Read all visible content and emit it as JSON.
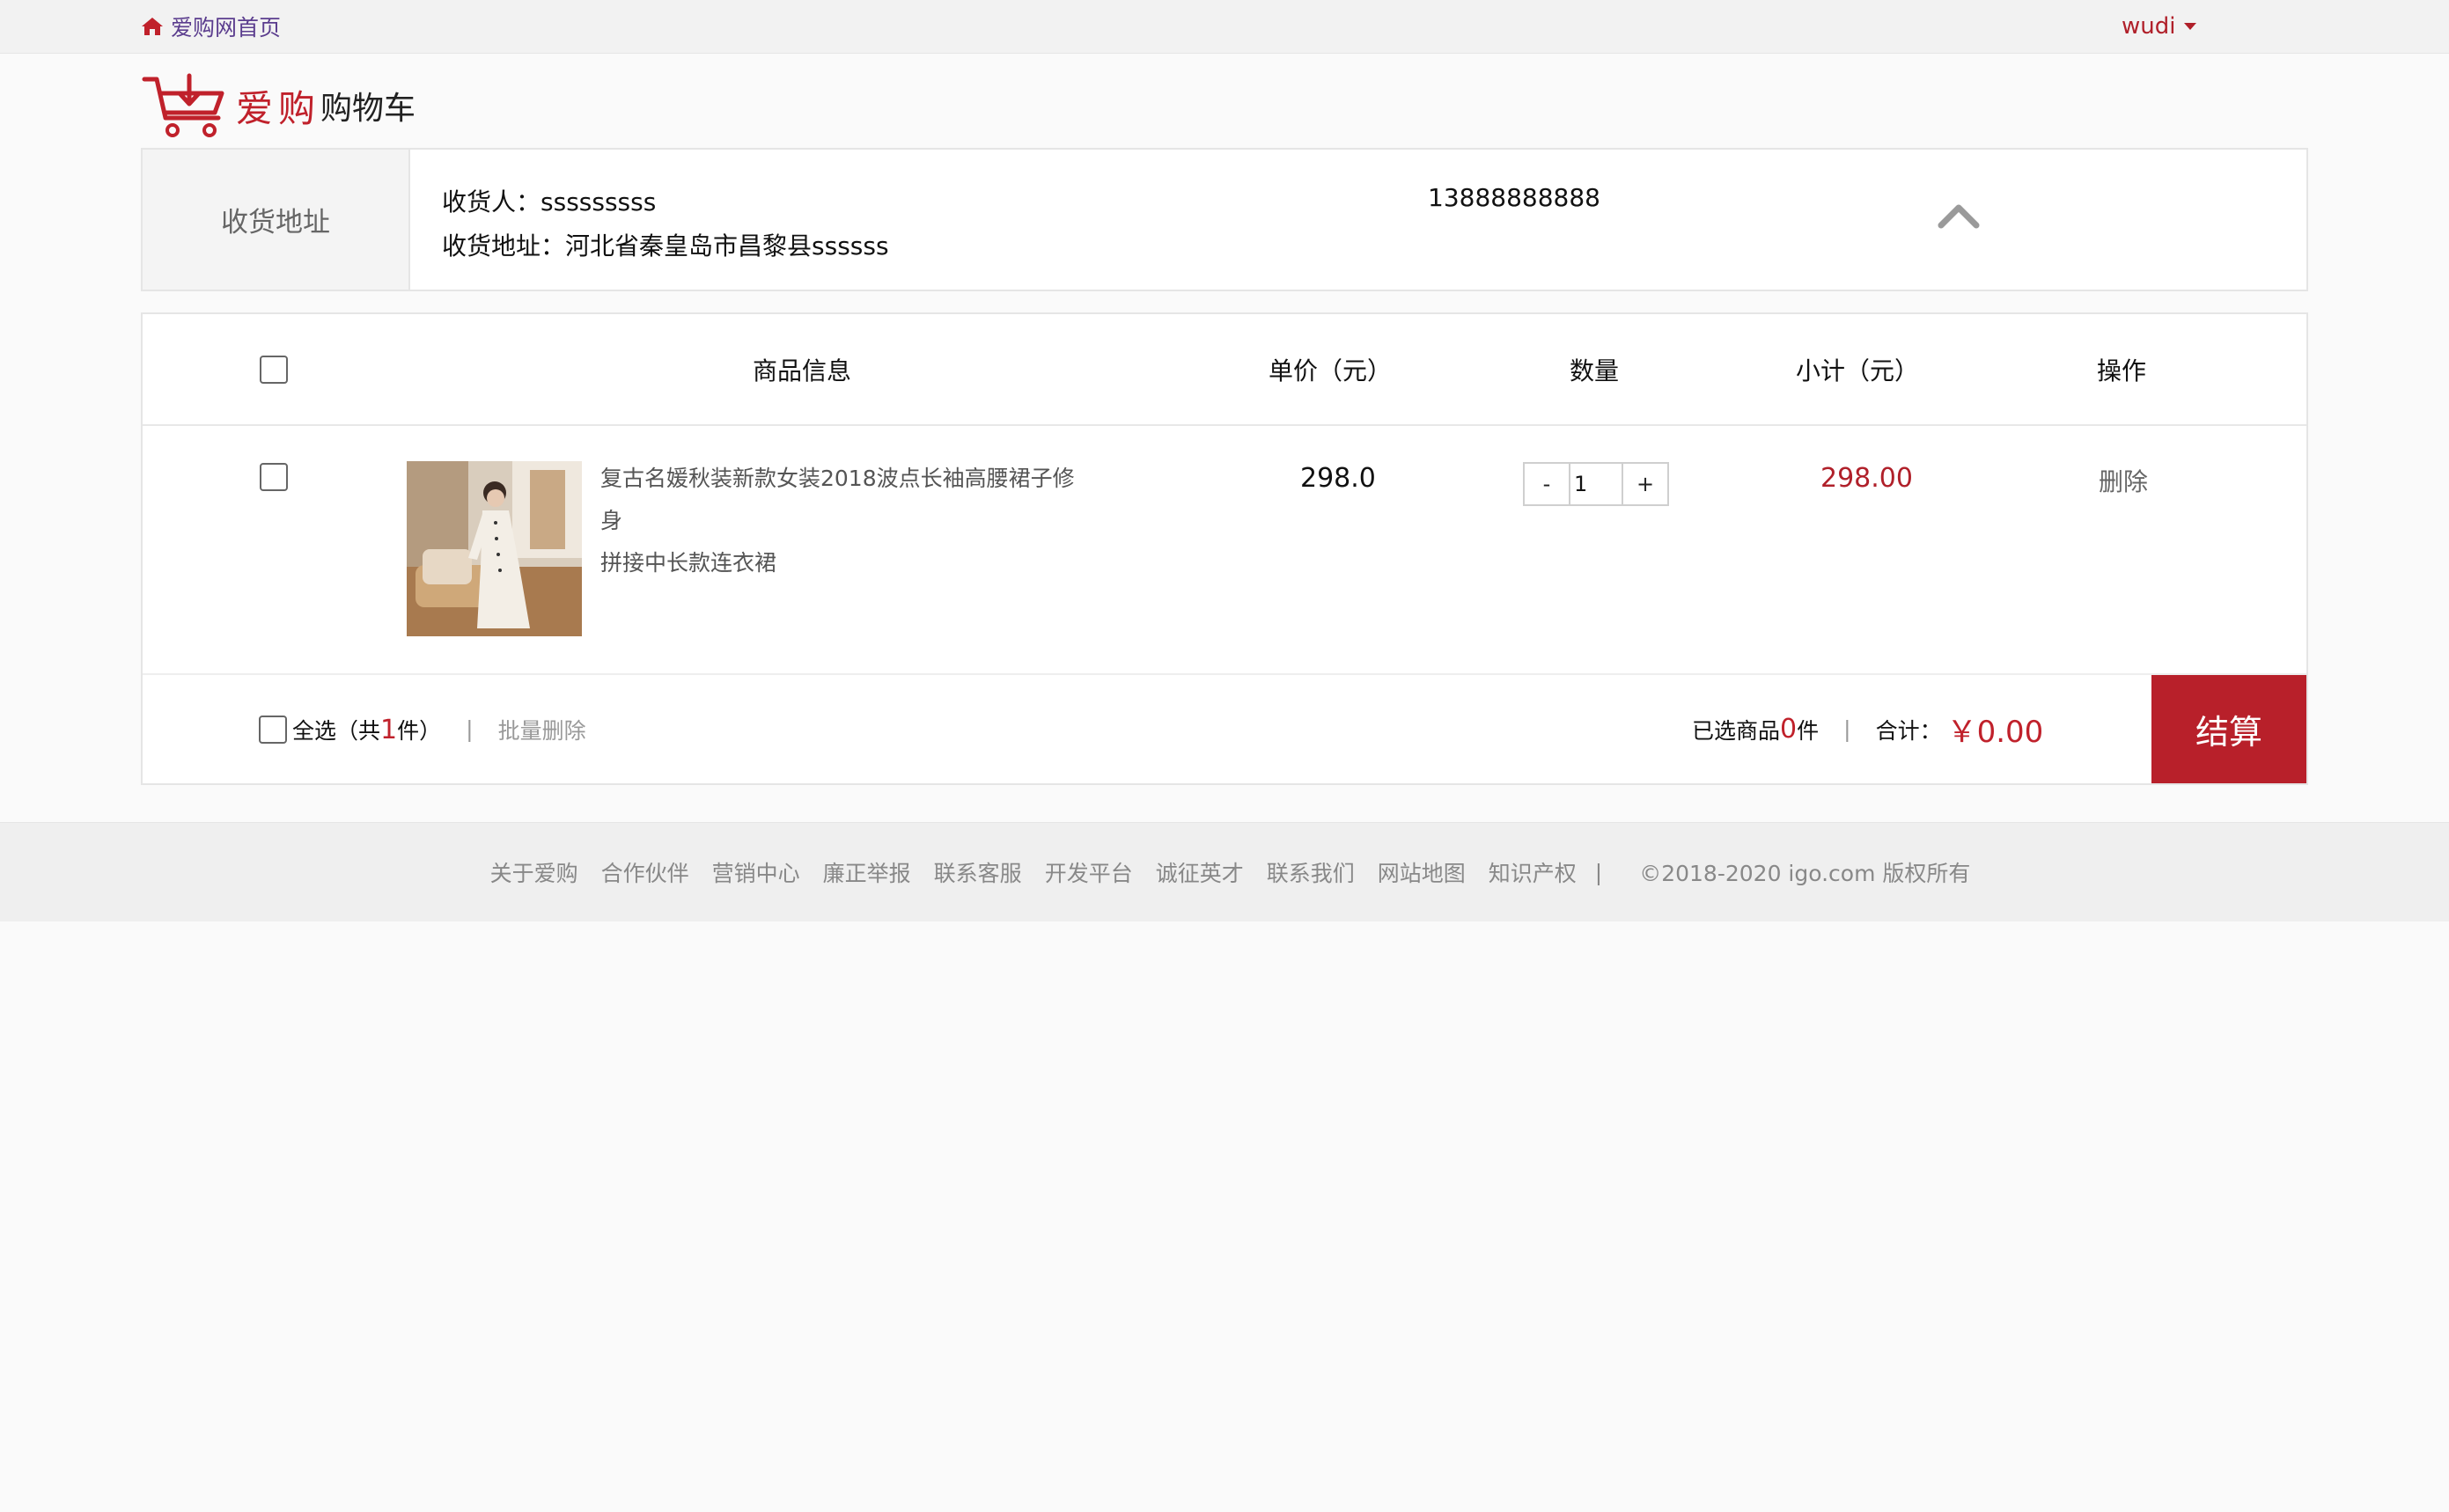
{
  "topbar": {
    "home_label": "爱购网首页",
    "user_name": "wudi"
  },
  "logo": {
    "brand": "爱购",
    "subtitle": "购物车"
  },
  "address": {
    "label": "收货地址",
    "receiver_label": "收货人：",
    "receiver_name": "sssssssss",
    "phone": "13888888888",
    "address_label": "收货地址：",
    "address_value": "河北省秦皇岛市昌黎县ssssss"
  },
  "cart": {
    "headers": {
      "product": "商品信息",
      "unit_price": "单价（元）",
      "quantity": "数量",
      "subtotal": "小计（元）",
      "action": "操作"
    },
    "items": [
      {
        "name_line1": "复古名媛秋装新款女装2018波点长袖高腰裙子修身",
        "name_line2": "拼接中长款连衣裙",
        "price": "298.0",
        "quantity": "1",
        "subtotal": "298.00",
        "delete_label": "删除",
        "minus_label": "-",
        "plus_label": "+"
      }
    ],
    "footer": {
      "select_all_prefix": "全选（共",
      "item_count": "1",
      "select_all_suffix": "件）",
      "separator": "|",
      "batch_delete": "批量删除",
      "selected_prefix": "已选商品",
      "selected_count": "0",
      "selected_suffix": "件",
      "total_label": "合计：",
      "total_value": "￥0.00",
      "checkout_label": "结算"
    }
  },
  "footer": {
    "links": [
      "关于爱购",
      "合作伙伴",
      "营销中心",
      "廉正举报",
      "联系客服",
      "开发平台",
      "诚征英才",
      "联系我们",
      "网站地图",
      "知识产权"
    ],
    "separator": "|",
    "copyright": "©2018-2020 igo.com 版权所有"
  },
  "colors": {
    "accent": "#b8202a",
    "price_red": "#b0202a",
    "home_link": "#5b3d8e"
  },
  "icons": {
    "home": "home-icon",
    "dropdown": "caret-down-icon",
    "cart_logo": "shopping-cart-icon",
    "collapse": "chevron-up-icon"
  }
}
